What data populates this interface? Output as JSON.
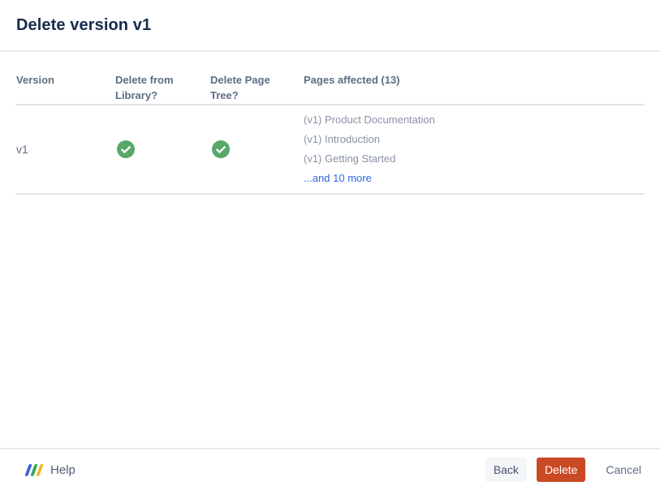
{
  "dialog": {
    "title": "Delete version v1"
  },
  "table": {
    "headers": [
      "Version",
      "Delete from Library?",
      "Delete Page Tree?",
      "Pages affected (13)"
    ],
    "row": {
      "version": "v1",
      "delete_from_library": "checked",
      "delete_page_tree": "checked",
      "pages": [
        "(v1) Product Documentation",
        "(v1) Introduction",
        "(v1) Getting Started"
      ],
      "more_link": "...and 10 more"
    }
  },
  "footer": {
    "help": "Help",
    "buttons": {
      "back": "Back",
      "delete": "Delete",
      "cancel": "Cancel"
    }
  },
  "icons": {
    "check": "check-circle-icon",
    "help_logo": "k15t-slashes-logo-icon"
  },
  "colors": {
    "title_text": "#172B4D",
    "header_text": "#5E6C84",
    "muted_text": "#8993A4",
    "link_blue": "#2F67E0",
    "check_green": "#57A869",
    "delete_button_bg": "#CA4A26",
    "delete_button_text": "#FFFFFF",
    "back_button_bg": "#F4F5F7",
    "back_button_text": "#42526E",
    "divider": "#E7E8E9",
    "logo_blue": "#3D64D8",
    "logo_green": "#3FA65C",
    "logo_yellow": "#F2BC26"
  }
}
